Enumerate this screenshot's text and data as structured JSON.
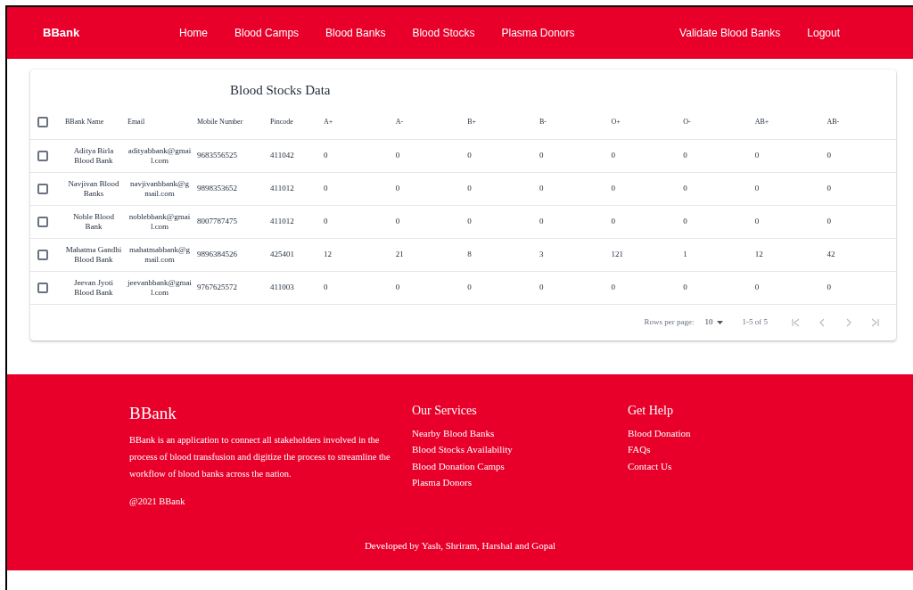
{
  "navbar": {
    "brand": "BBank",
    "links": [
      "Home",
      "Blood Camps",
      "Blood Banks",
      "Blood Stocks",
      "Plasma Donors"
    ],
    "right_links": [
      "Validate Blood Banks",
      "Logout"
    ]
  },
  "table": {
    "title": "Blood Stocks Data",
    "select_all": {
      "checked": false
    },
    "columns": [
      "BBank Name",
      "Email",
      "Mobile Number",
      "Pincode",
      "A+",
      "A-",
      "B+",
      "B-",
      "O+",
      "O-",
      "AB+",
      "AB-"
    ],
    "rows": [
      {
        "selected": false,
        "cells": [
          "Aditya Birla Blood Bank",
          "adityabbank@gmail.com",
          "9683556525",
          "411042",
          "0",
          "0",
          "0",
          "0",
          "0",
          "0",
          "0",
          "0"
        ]
      },
      {
        "selected": false,
        "cells": [
          "Navjivan Blood Banks",
          "navjivanbbank@gmail.com",
          "9898353652",
          "411012",
          "0",
          "0",
          "0",
          "0",
          "0",
          "0",
          "0",
          "0"
        ]
      },
      {
        "selected": false,
        "cells": [
          "Noble Blood Bank",
          "noblebbank@gmail.com",
          "8007787475",
          "411012",
          "0",
          "0",
          "0",
          "0",
          "0",
          "0",
          "0",
          "0"
        ]
      },
      {
        "selected": false,
        "cells": [
          "Mahatma Gandhi Blood Bank",
          "mahatmabbank@gmail.com",
          "9896384526",
          "425401",
          "12",
          "21",
          "8",
          "3",
          "121",
          "1",
          "12",
          "42"
        ]
      },
      {
        "selected": false,
        "cells": [
          "Jeevan Jyoti Blood Bank",
          "jeevanbbank@gmail.com",
          "9767625572",
          "411003",
          "0",
          "0",
          "0",
          "0",
          "0",
          "0",
          "0",
          "0"
        ]
      }
    ],
    "pagination": {
      "rows_per_page_label": "Rows per page:",
      "rows_per_page": "10",
      "range": "1-5 of 5"
    }
  },
  "footer": {
    "brand": "BBank",
    "description": "BBank is an application to connect all stakeholders involved in the process of blood transfusion and digitize the process to streamline the workflow of blood banks across the nation.",
    "copyright": "@2021 BBank",
    "services": {
      "heading": "Our Services",
      "links": [
        "Nearby Blood Banks",
        "Blood Stocks Availability",
        "Blood Donation Camps",
        "Plasma Donors"
      ]
    },
    "help": {
      "heading": "Get Help",
      "links": [
        "Blood Donation",
        "FAQs",
        "Contact Us"
      ]
    },
    "credits": "Developed by Yash, Shriram, Harshal and Gopal"
  }
}
